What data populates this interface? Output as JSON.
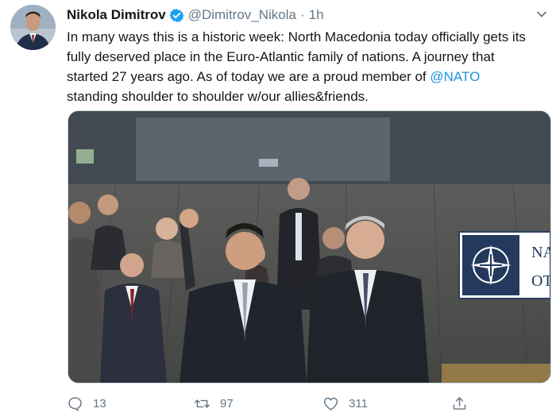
{
  "tweet": {
    "author_name": "Nikola Dimitrov",
    "handle": "@Dimitrov_Nikola",
    "separator": "·",
    "time": "1h",
    "verified": true,
    "text_lines": [
      "In many ways this is a historic week: North Macedonia today officially gets its",
      "fully deserved place in the Euro-Atlantic family of nations. A journey that",
      "started 27 years ago. As of today we are a proud member of ",
      "standing shoulder to shoulder w/our allies&friends."
    ],
    "mention": "@NATO",
    "media_sign_text": "NA\nOT"
  },
  "actions": {
    "reply_count": "13",
    "retweet_count": "97",
    "like_count": "311"
  },
  "colors": {
    "accent": "#1da1f2",
    "mention": "#1b95e0",
    "secondary_text": "#657786"
  },
  "icons": [
    "verified-badge-icon",
    "chevron-down-icon",
    "reply-icon",
    "retweet-icon",
    "like-icon",
    "share-icon"
  ]
}
